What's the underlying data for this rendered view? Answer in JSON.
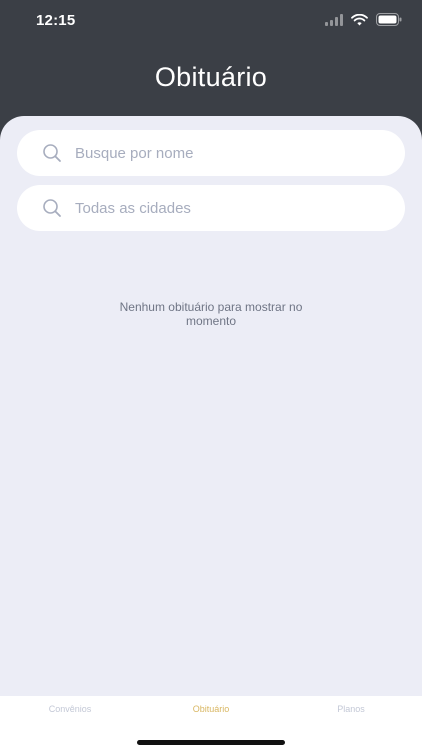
{
  "status_bar": {
    "time": "12:15",
    "icons": [
      "signal-icon",
      "wifi-icon",
      "battery-icon"
    ]
  },
  "header": {
    "title": "Obituário"
  },
  "search": {
    "name_placeholder": "Busque por nome",
    "city_placeholder": "Todas as cidades",
    "icon": "search-icon"
  },
  "main": {
    "empty_message": "Nenhum obituário para mostrar no momento"
  },
  "tabs": [
    {
      "label": "Convênios",
      "active": false
    },
    {
      "label": "Obituário",
      "active": true
    },
    {
      "label": "Planos",
      "active": false
    }
  ],
  "colors": {
    "header_bg": "#3b3f46",
    "content_bg": "#ecedf6",
    "active_tab": "#d9b763",
    "inactive_tab": "#c3c8d6"
  }
}
